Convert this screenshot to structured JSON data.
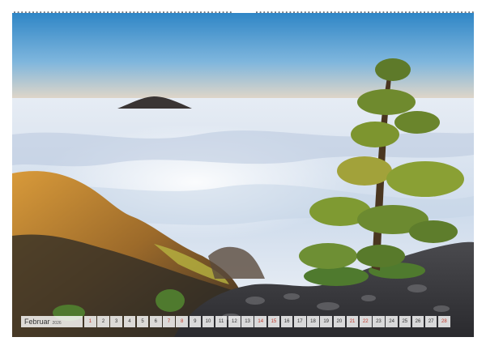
{
  "calendar": {
    "month": "Februar",
    "year": "2026",
    "days": [
      {
        "n": "1",
        "weekend": true
      },
      {
        "n": "2",
        "weekend": false
      },
      {
        "n": "3",
        "weekend": false
      },
      {
        "n": "4",
        "weekend": false
      },
      {
        "n": "5",
        "weekend": false
      },
      {
        "n": "6",
        "weekend": false
      },
      {
        "n": "7",
        "weekend": true
      },
      {
        "n": "8",
        "weekend": true
      },
      {
        "n": "9",
        "weekend": false
      },
      {
        "n": "10",
        "weekend": false
      },
      {
        "n": "11",
        "weekend": false
      },
      {
        "n": "12",
        "weekend": false
      },
      {
        "n": "13",
        "weekend": false
      },
      {
        "n": "14",
        "weekend": true
      },
      {
        "n": "15",
        "weekend": true
      },
      {
        "n": "16",
        "weekend": false
      },
      {
        "n": "17",
        "weekend": false
      },
      {
        "n": "18",
        "weekend": false
      },
      {
        "n": "19",
        "weekend": false
      },
      {
        "n": "20",
        "weekend": false
      },
      {
        "n": "21",
        "weekend": true
      },
      {
        "n": "22",
        "weekend": true
      },
      {
        "n": "23",
        "weekend": false
      },
      {
        "n": "24",
        "weekend": false
      },
      {
        "n": "25",
        "weekend": false
      },
      {
        "n": "26",
        "weekend": false
      },
      {
        "n": "27",
        "weekend": false
      },
      {
        "n": "28",
        "weekend": true
      }
    ]
  },
  "colors": {
    "weekend": "#c0392b",
    "weekday": "#333333",
    "sky_top": "#2f86c6",
    "sea_of_clouds": "#e8eef6"
  }
}
